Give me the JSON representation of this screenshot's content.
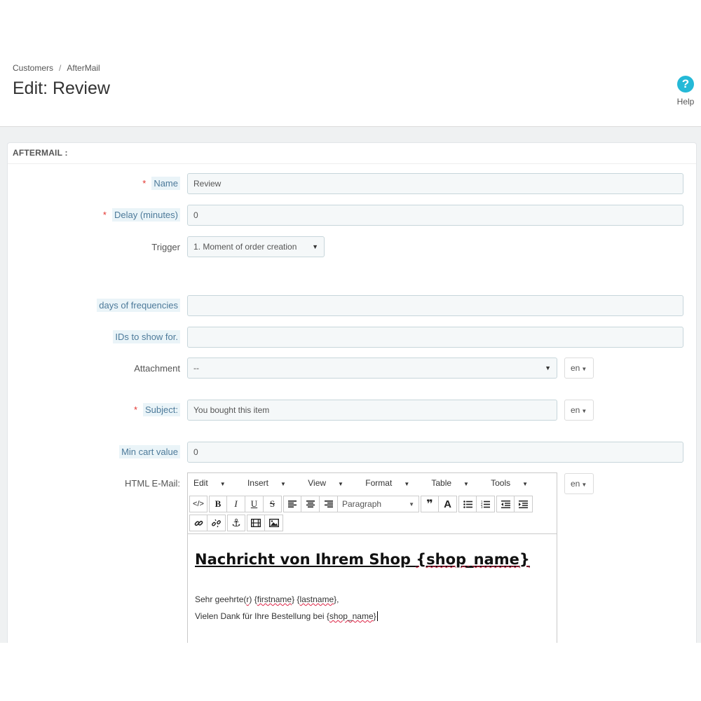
{
  "breadcrumb": {
    "parent": "Customers",
    "separator": "/",
    "current": "AfterMail"
  },
  "page_title": "Edit: Review",
  "help": {
    "icon_char": "?",
    "label": "Help"
  },
  "panel": {
    "heading": "AFTERMAIL :"
  },
  "form": {
    "name": {
      "required_mark": "*",
      "label": "Name",
      "value": "Review"
    },
    "delay": {
      "required_mark": "*",
      "label": "Delay (minutes)",
      "value": "0"
    },
    "trigger": {
      "label": "Trigger",
      "value": "1. Moment of order creation"
    },
    "frequencies": {
      "label": "days of frequencies",
      "value": ""
    },
    "ids": {
      "label": "IDs to show for.",
      "value": ""
    },
    "attachment": {
      "label": "Attachment",
      "value": "--",
      "lang": "en"
    },
    "subject": {
      "required_mark": "*",
      "label": "Subject:",
      "value": "You bought this item",
      "lang": "en"
    },
    "min_cart": {
      "label": "Min cart value",
      "value": "0"
    },
    "html_email": {
      "label": "HTML E-Mail:",
      "lang": "en"
    }
  },
  "editor": {
    "menus": [
      "Edit",
      "Insert",
      "View",
      "Format",
      "Table",
      "Tools"
    ],
    "format_value": "Paragraph",
    "content": {
      "heading_prefix": "Nachricht von Ihrem Shop ",
      "heading_var": "{shop_name}",
      "salutation_start": "Sehr geehrte(",
      "salutation_r": "r",
      "salutation_mid": ") {",
      "salutation_first": "firstname",
      "salutation_sep": "} {",
      "salutation_last": "lastname",
      "salutation_end": "},",
      "thanks_start": "Vielen Dank für Ihre Bestellung bei {",
      "thanks_var": "shop_name",
      "thanks_end": "}"
    }
  }
}
